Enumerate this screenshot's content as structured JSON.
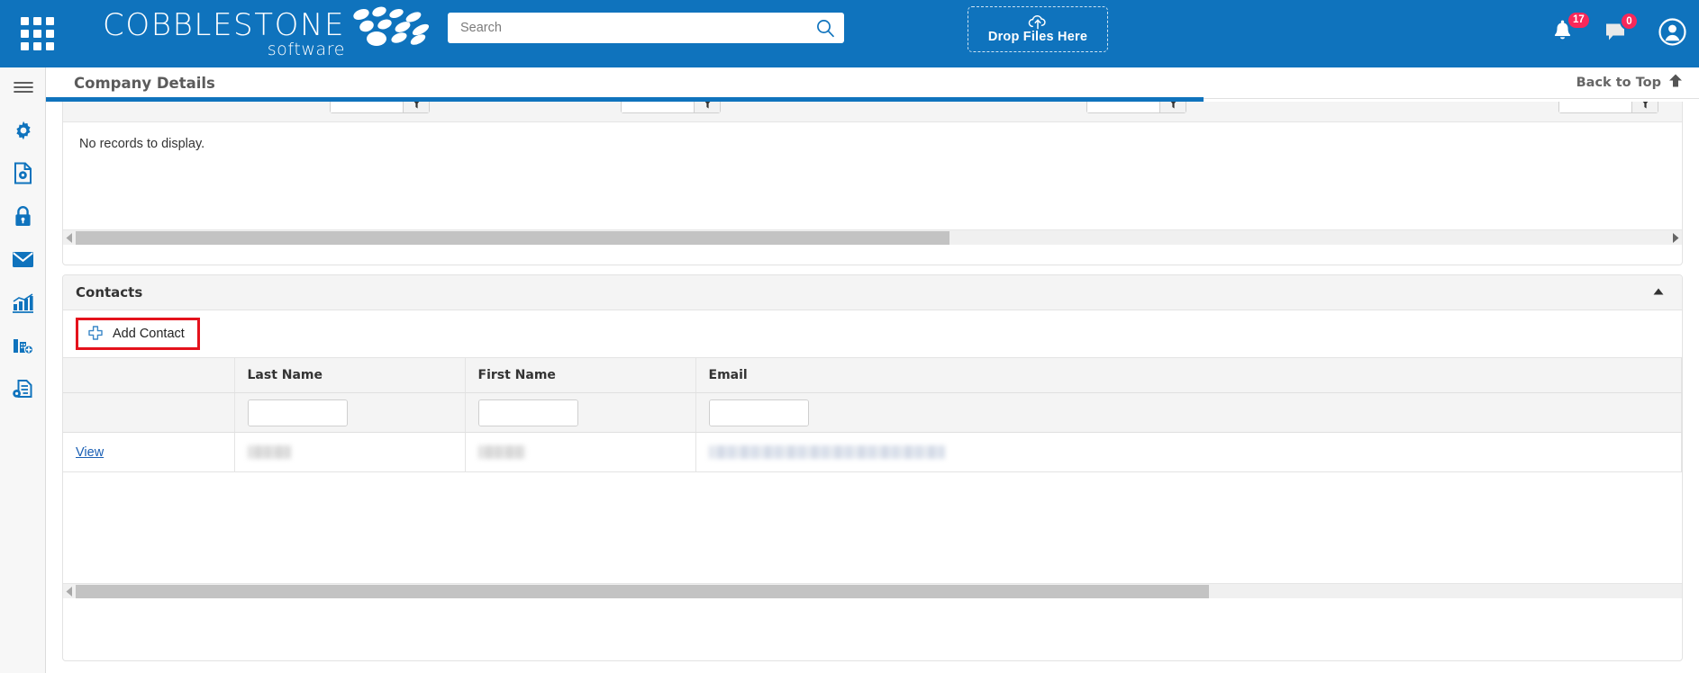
{
  "header": {
    "brand_main": "COBBLESTONE",
    "brand_sub": "software",
    "apps_icon": "apps-grid-icon",
    "search": {
      "placeholder": "Search",
      "value": "",
      "icon": "search-icon"
    },
    "dropzone": {
      "label": "Drop Files Here",
      "icon": "cloud-upload-icon"
    },
    "notifications": {
      "icon": "bell-icon",
      "count": "17"
    },
    "messages": {
      "icon": "chat-bubble-icon",
      "count": "0"
    },
    "account": {
      "icon": "user-avatar-icon"
    },
    "accent_color": "#0f73bd",
    "badge_color": "#f8285a"
  },
  "sidebar": {
    "items": [
      {
        "name": "menu-toggle",
        "icon": "hamburger-icon"
      },
      {
        "name": "settings",
        "icon": "gear-icon"
      },
      {
        "name": "document-settings",
        "icon": "document-gear-icon"
      },
      {
        "name": "security",
        "icon": "lock-icon"
      },
      {
        "name": "mail",
        "icon": "envelope-icon"
      },
      {
        "name": "reports",
        "icon": "bar-chart-icon"
      },
      {
        "name": "add-record",
        "icon": "building-add-icon"
      },
      {
        "name": "document-config",
        "icon": "file-gear-icon"
      }
    ]
  },
  "titlebar": {
    "page_title": "Company Details",
    "back_to_top": "Back to Top",
    "back_to_top_icon": "arrow-up-icon"
  },
  "progress": {
    "percent": 70
  },
  "top_panel": {
    "empty_message": "No records to display.",
    "filter_icon": "funnel-icon",
    "scrollbar": {
      "left_arrow": "◀",
      "right_arrow": "▶",
      "thumb_start_pct": 0,
      "thumb_width_pct": 54
    }
  },
  "contacts": {
    "section_title": "Contacts",
    "collapse_icon": "triangle-up-icon",
    "add_button": {
      "label": "Add Contact",
      "icon": "plus-cross-icon",
      "highlight_color": "#e4121c"
    },
    "columns": [
      "",
      "Last Name",
      "First Name",
      "Email"
    ],
    "filter_icon": "funnel-icon",
    "filters": {
      "last_name": "",
      "first_name": "",
      "email": ""
    },
    "rows": [
      {
        "action": "View",
        "last_name": "",
        "first_name": "",
        "email": "",
        "redacted": true
      }
    ],
    "scrollbar": {
      "left_arrow": "◀",
      "right_arrow": "▶",
      "thumb_start_pct": 0,
      "thumb_width_pct": 70
    }
  }
}
